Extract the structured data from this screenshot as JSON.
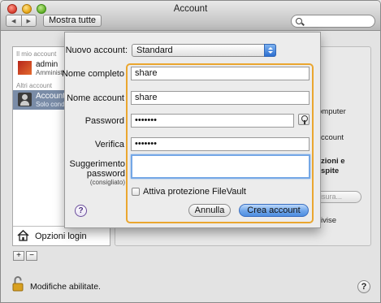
{
  "window": {
    "title": "Account",
    "nav_back": "◀",
    "nav_forward": "▶",
    "show_all": "Mostra tutte",
    "search_placeholder": ""
  },
  "sidebar": {
    "group_my_account": "Il mio account",
    "group_other_accounts": "Altri account",
    "accounts": [
      {
        "name": "admin",
        "role": "Amministr"
      },
      {
        "name": "Account",
        "role": "Solo cond"
      }
    ],
    "login_options": "Opzioni login",
    "add_label": "+",
    "remove_label": "−"
  },
  "background_panel": {
    "fragments": [
      "omputer",
      "ccount",
      "zioni e",
      "spite",
      "isura...",
      "ivise"
    ],
    "partial_button": "isura..."
  },
  "sheet": {
    "new_account_label": "Nuovo account:",
    "new_account_value": "Standard",
    "full_name_label": "Nome completo",
    "full_name_value": "share",
    "account_name_label": "Nome account",
    "account_name_value": "share",
    "password_label": "Password",
    "password_value": "•••••••",
    "verify_label": "Verifica",
    "verify_value": "•••••••",
    "hint_label_1": "Suggerimento",
    "hint_label_2": "password",
    "hint_label_3": "(consigliato)",
    "hint_value": "",
    "filevault_label": "Attiva protezione FileVault",
    "cancel_label": "Annulla",
    "create_label": "Crea account",
    "help_label": "?"
  },
  "footer": {
    "lock_text": "Modifiche abilitate.",
    "help_label": "?"
  }
}
